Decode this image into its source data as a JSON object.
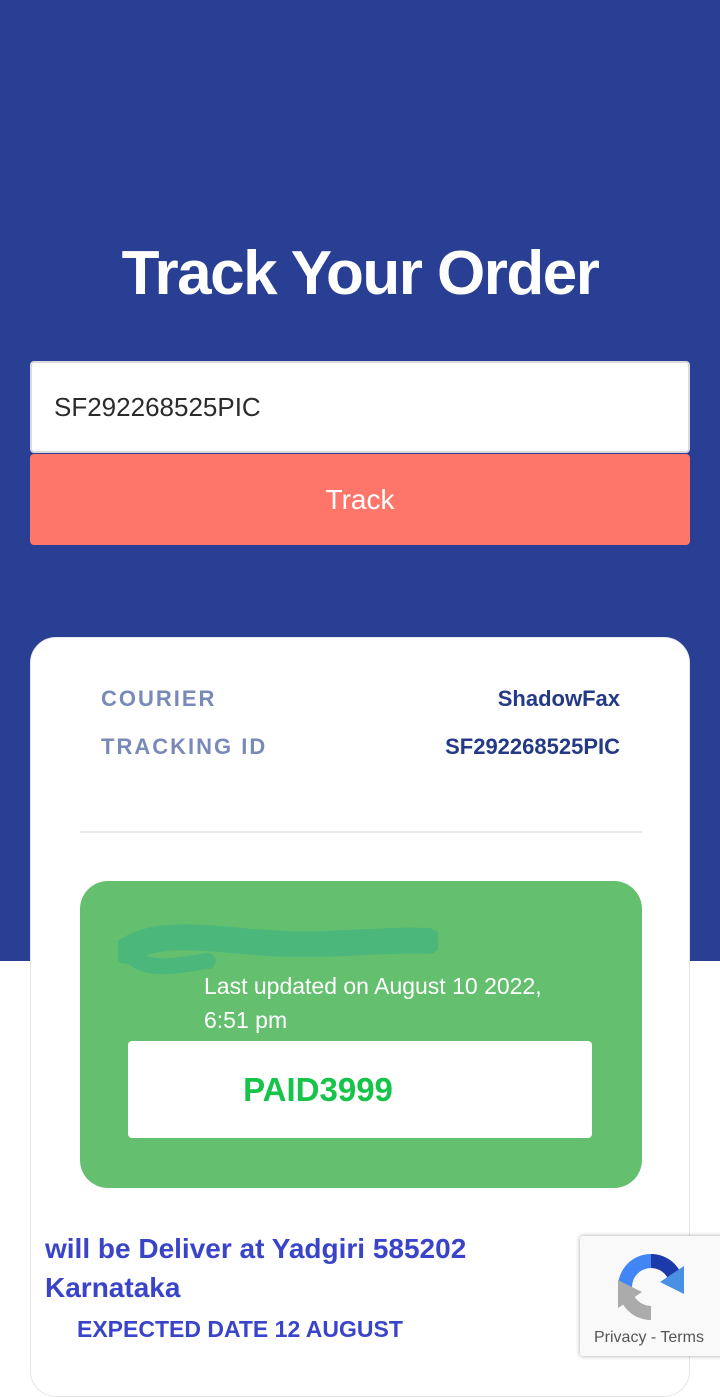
{
  "header": {
    "title": "Track Your Order"
  },
  "search": {
    "value": "SF292268525PIC",
    "button_label": "Track"
  },
  "result": {
    "courier_label": "COURIER",
    "courier_value": "ShadowFax",
    "tracking_label": "TRACKING ID",
    "tracking_value": "SF292268525PIC",
    "last_updated_line1": "Last updated on August 10  2022,",
    "last_updated_line2": "6:51 pm",
    "status": "PAID3999",
    "delivery_line1": "will be Deliver at Yadgiri 585202",
    "delivery_line2": "Karnataka",
    "expected": "EXPECTED DATE 12 AUGUST"
  },
  "recaptcha": {
    "privacy": "Privacy",
    "separator": "-",
    "terms": "Terms"
  },
  "colors": {
    "header_bg": "#283f94",
    "track_button": "#fe766a",
    "status_bg": "#64c06f",
    "paid_text": "#18c34a",
    "delivery_text": "#3a44c8"
  }
}
